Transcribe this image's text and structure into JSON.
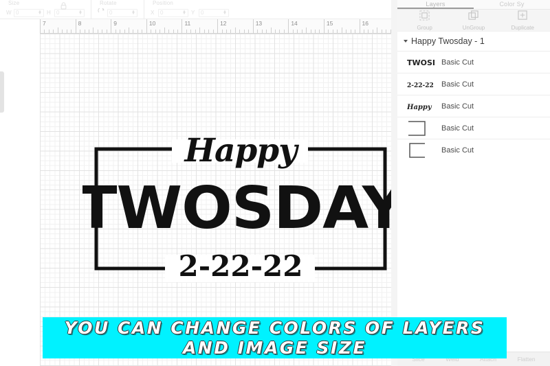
{
  "toolbar": {
    "groups": [
      {
        "label": "Size",
        "lock_icon": "lock-icon",
        "fields": [
          {
            "tag": "W",
            "value": "0",
            "placeholder": "0"
          },
          {
            "tag": "H",
            "value": "0",
            "placeholder": "0"
          }
        ]
      },
      {
        "label": "Rotate",
        "icon": "rotate-icon",
        "fields": [
          {
            "tag": "",
            "value": "0",
            "placeholder": "0"
          }
        ]
      },
      {
        "label": "Position",
        "fields": [
          {
            "tag": "X",
            "value": "0",
            "placeholder": "0"
          },
          {
            "tag": "Y",
            "value": "0",
            "placeholder": "0"
          }
        ]
      }
    ]
  },
  "ruler": {
    "unit": "in",
    "ticks": [
      "7",
      "8",
      "9",
      "10",
      "11",
      "12",
      "13",
      "14",
      "15",
      "16"
    ]
  },
  "artwork": {
    "script_text": "Happy",
    "main_text": "TWOSDAY",
    "date_text": "2-22-22",
    "stroke_color": "#111111"
  },
  "panel": {
    "tabs": [
      {
        "label": "Layers",
        "active": true
      },
      {
        "label": "Color Sy",
        "active": false
      }
    ],
    "actions": [
      {
        "label": "Group",
        "icon": "group-icon"
      },
      {
        "label": "UnGroup",
        "icon": "ungroup-icon"
      },
      {
        "label": "Duplicate",
        "icon": "duplicate-icon"
      }
    ],
    "group": {
      "title": "Happy Twosday - 1",
      "expanded": true
    },
    "layers": [
      {
        "thumb": "twosday-thumb",
        "thumb_text": "TWOSDAY",
        "name": "Basic Cut"
      },
      {
        "thumb": "date-thumb",
        "thumb_text": "2-22-22",
        "name": "Basic Cut"
      },
      {
        "thumb": "happy-thumb",
        "thumb_text": "Happy",
        "name": "Basic Cut"
      },
      {
        "thumb": "bracket-right-thumb",
        "thumb_text": "",
        "name": "Basic Cut"
      },
      {
        "thumb": "bracket-left-thumb",
        "thumb_text": "",
        "name": "Basic Cut"
      }
    ],
    "bottom_actions": [
      {
        "label": "Slice"
      },
      {
        "label": "Weld"
      },
      {
        "label": "Attach"
      },
      {
        "label": "Flatten"
      }
    ]
  },
  "banner": {
    "line1": "YOU CAN CHANGE COLORS OF LAYERS",
    "line2": "AND IMAGE SIZE",
    "background_color": "#00f2ff",
    "text_color": "#ffffff"
  }
}
